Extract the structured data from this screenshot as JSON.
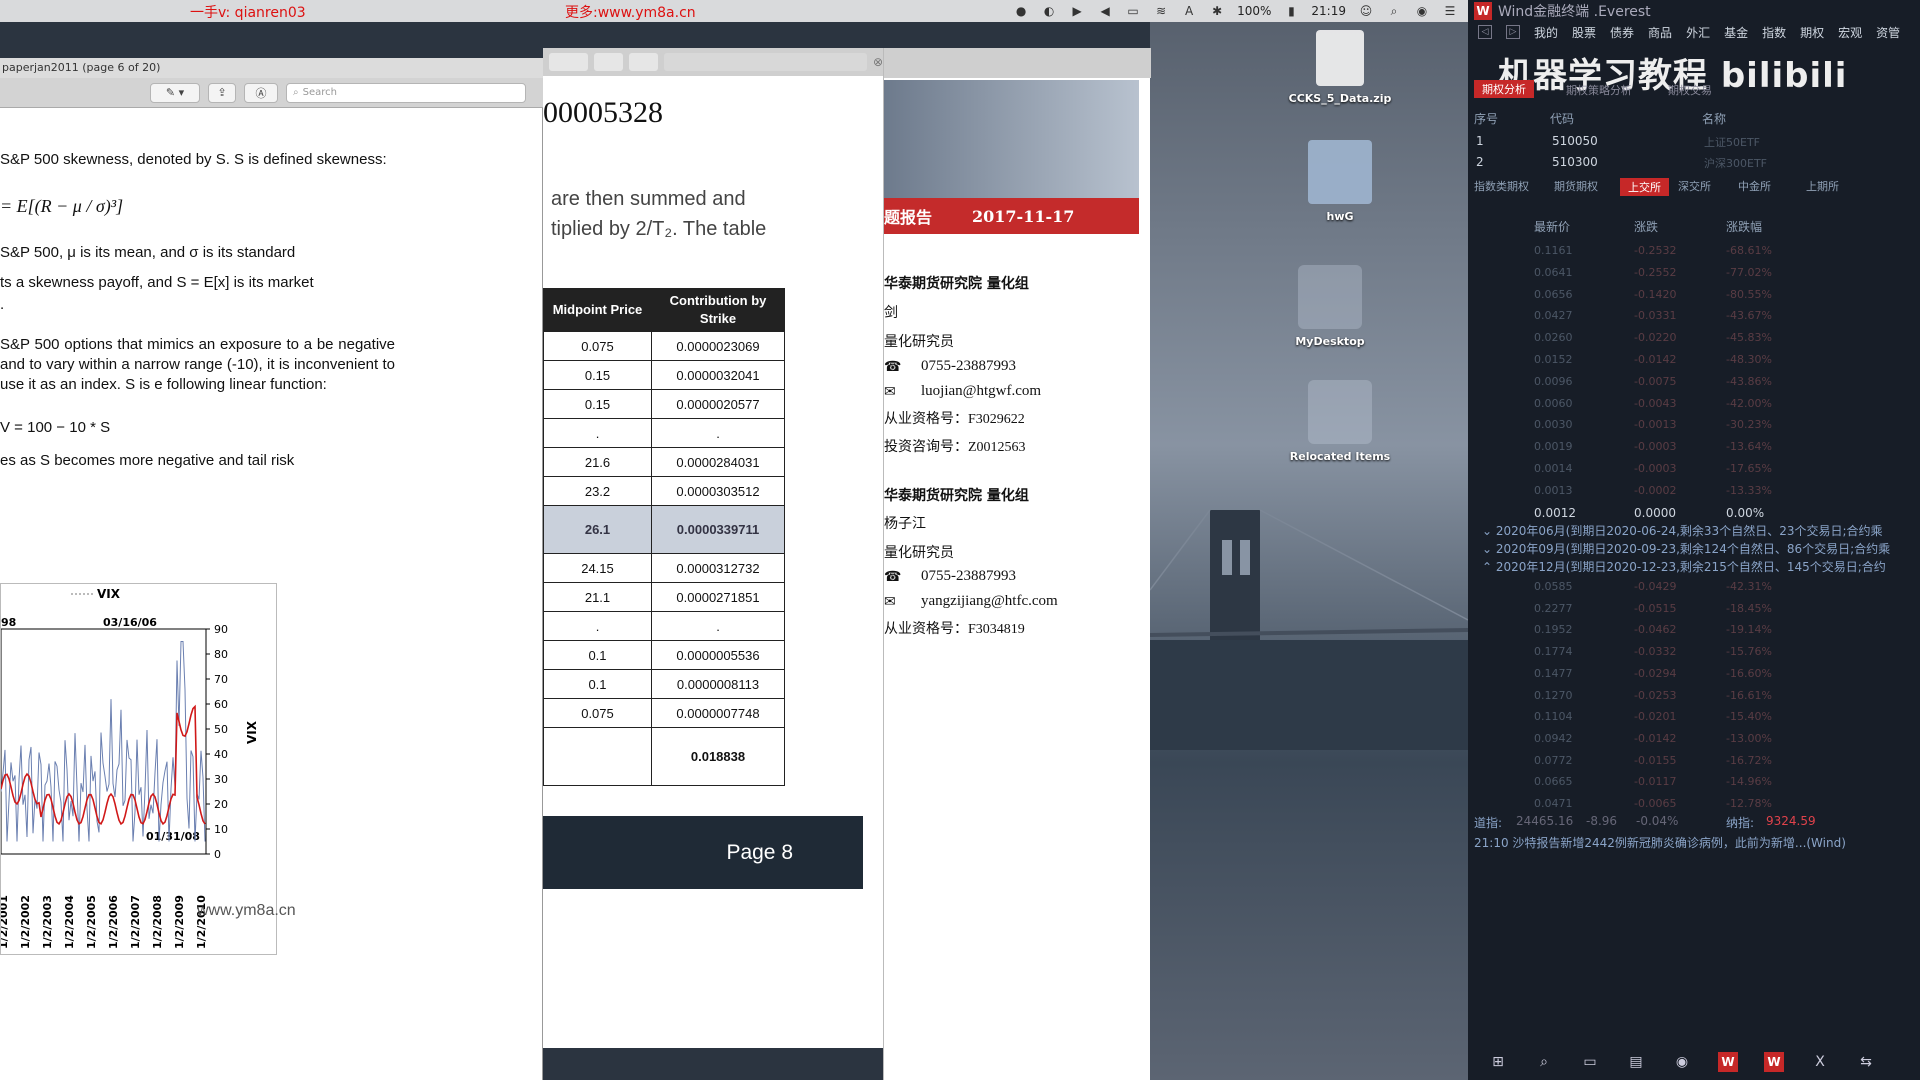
{
  "menubar": {
    "watermark_left": "一手v: qianren03",
    "watermark_mid": "更多:www.ym8a.cn",
    "battery": "100%",
    "time": "21:19"
  },
  "pdf": {
    "window_title": "paperjan2011 (page 6 of 20)",
    "search_placeholder": "Search",
    "para1": "S&P 500 skewness, denoted by S. S is defined skewness:",
    "formula_skew": "= E[(R − μ / σ)³]",
    "para2": "S&P 500, μ is its mean, and σ is its standard",
    "para3": "ts a skewness payoff, and S = E[x] is its market",
    "para3b": ".",
    "para4": "S&P 500 options that mimics an exposure to a be negative and to vary within a narrow range (-10), it is inconvenient to use it as an index. S is e following linear function:",
    "formula_w": "V = 100 − 10 * S",
    "para5": "es as S becomes more negative and tail risk",
    "chart_watermark": "www.ym8a.cn"
  },
  "chart_data": {
    "type": "line",
    "legend": [
      "VIX"
    ],
    "ylabel_right": "VIX",
    "yticks": [
      0,
      10,
      20,
      30,
      40,
      50,
      60,
      70,
      80,
      90
    ],
    "xticks": [
      "1/2/2001",
      "1/2/2002",
      "1/2/2003",
      "1/2/2004",
      "1/2/2005",
      "1/2/2006",
      "1/2/2007",
      "1/2/2008",
      "1/2/2009",
      "1/2/2010"
    ],
    "annotations": [
      "98",
      "03/16/06",
      "01/31/08"
    ],
    "ylim": [
      0,
      90
    ]
  },
  "middle": {
    "title_number": "00005328",
    "line1": "are then summed and",
    "line2": "tiplied by 2/T₂.  The table",
    "table_headers": [
      "Midpoint Price",
      "Contribution by Strike"
    ],
    "rows": [
      [
        "0.075",
        "0.0000023069"
      ],
      [
        "0.15",
        "0.0000032041"
      ],
      [
        "0.15",
        "0.0000020577"
      ],
      [
        ".",
        "."
      ],
      [
        "21.6",
        "0.0000284031"
      ],
      [
        "23.2",
        "0.0000303512"
      ],
      [
        "26.1",
        "0.0000339711"
      ],
      [
        "24.15",
        "0.0000312732"
      ],
      [
        "21.1",
        "0.0000271851"
      ],
      [
        ".",
        "."
      ],
      [
        "0.1",
        "0.0000005536"
      ],
      [
        "0.1",
        "0.0000008113"
      ],
      [
        "0.075",
        "0.0000007748"
      ],
      [
        "",
        "0.018838"
      ]
    ],
    "footer": "Page 8"
  },
  "report": {
    "banner_left": "题报告",
    "banner_date": "2017-11-17",
    "org1": "华泰期货研究院  量化组",
    "name1": "剑",
    "role1": "量化研究员",
    "phone1": "0755-23887993",
    "email1": "luojian@htgwf.com",
    "cert1_label": "从业资格号：",
    "cert1": "F3029622",
    "cert2_label": "投资咨询号：",
    "cert2": "Z0012563",
    "org2": "华泰期货研究院  量化组",
    "name2": "杨子江",
    "role2": "量化研究员",
    "phone2": "0755-23887993",
    "email2": "yangzijiang@htfc.com",
    "cert3_label": "从业资格号：",
    "cert3": "F3034819"
  },
  "desktop": {
    "icons": [
      "CCKS_5_Data.zip",
      "hwG",
      "MyDesktop",
      "Relocated Items"
    ]
  },
  "wind": {
    "title": "Wind金融终端 .Everest",
    "menu": [
      "我的",
      "股票",
      "债券",
      "商品",
      "外汇",
      "基金",
      "指数",
      "期权",
      "宏观",
      "资管"
    ],
    "bili_text": "机器学习教程 bilibili",
    "subtabs": [
      "期权分析",
      "期权策略分析",
      "期权交易"
    ],
    "col_headers": [
      "序号",
      "代码",
      "名称"
    ],
    "etf_rows": [
      [
        "1",
        "510050",
        "上证50ETF"
      ],
      [
        "2",
        "510300",
        "沪深300ETF"
      ]
    ],
    "exchange_tabs": [
      "指数类期权",
      "期货期权",
      "上交所",
      "深交所",
      "中金所",
      "上期所"
    ],
    "price_headers": [
      "最新价",
      "涨跌",
      "涨跌幅"
    ],
    "price_rows_top": [
      [
        "0.1161",
        "-0.2532",
        "-68.61%"
      ],
      [
        "0.0641",
        "-0.2552",
        "-77.02%"
      ],
      [
        "0.0656",
        "-0.1420",
        "-80.55%"
      ],
      [
        "0.0427",
        "-0.0331",
        "-43.67%"
      ],
      [
        "0.0260",
        "-0.0220",
        "-45.83%"
      ],
      [
        "0.0152",
        "-0.0142",
        "-48.30%"
      ],
      [
        "0.0096",
        "-0.0075",
        "-43.86%"
      ],
      [
        "0.0060",
        "-0.0043",
        "-42.00%"
      ],
      [
        "0.0030",
        "-0.0013",
        "-30.23%"
      ],
      [
        "0.0019",
        "-0.0003",
        "-13.64%"
      ],
      [
        "0.0014",
        "-0.0003",
        "-17.65%"
      ],
      [
        "0.0013",
        "-0.0002",
        "-13.33%"
      ],
      [
        "0.0012",
        "0.0000",
        "0.00%"
      ]
    ],
    "option_months": [
      "2020年06月(到期日2020-06-24,剩余33个自然日、23个交易日;合约乘",
      "2020年09月(到期日2020-09-23,剩余124个自然日、86个交易日;合约乘",
      "2020年12月(到期日2020-12-23,剩余215个自然日、145个交易日;合约"
    ],
    "price_rows_bottom": [
      [
        "0.0585",
        "-0.0429",
        "-42.31%"
      ],
      [
        "0.2277",
        "-0.0515",
        "-18.45%"
      ],
      [
        "0.1952",
        "-0.0462",
        "-19.14%"
      ],
      [
        "0.1774",
        "-0.0332",
        "-15.76%"
      ],
      [
        "0.1477",
        "-0.0294",
        "-16.60%"
      ],
      [
        "0.1270",
        "-0.0253",
        "-16.61%"
      ],
      [
        "0.1104",
        "-0.0201",
        "-15.40%"
      ],
      [
        "0.0942",
        "-0.0142",
        "-13.00%"
      ],
      [
        "0.0772",
        "-0.0155",
        "-16.72%"
      ],
      [
        "0.0665",
        "-0.0117",
        "-14.96%"
      ],
      [
        "0.0471",
        "-0.0065",
        "-12.78%"
      ]
    ],
    "status_index_label": "道指:",
    "status_index_val": "24465.16",
    "status_index_chg": "-8.96",
    "status_index_pct": "-0.04%",
    "status_nas_label": "纳指:",
    "status_nas_val": "9324.59",
    "news": "21:10 沙特报告新增2442例新冠肺炎确诊病例，此前为新增...(Wind)"
  }
}
